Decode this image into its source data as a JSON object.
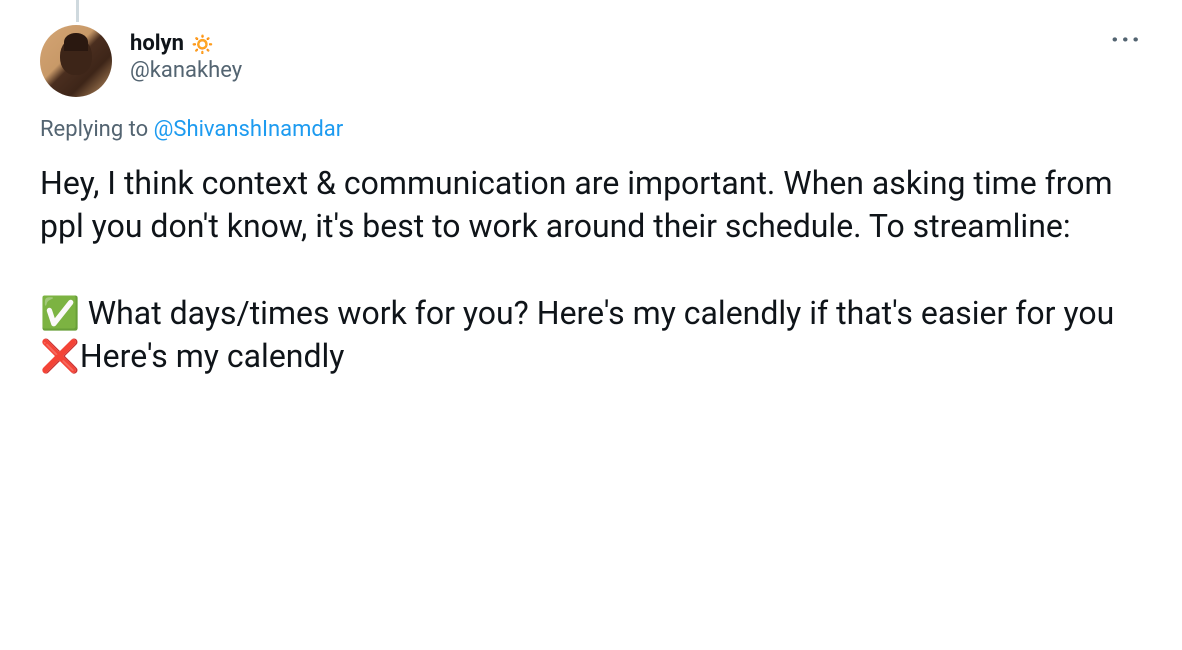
{
  "user": {
    "display_name": "holyn",
    "name_emoji": "🔅",
    "handle": "@kanakhey"
  },
  "reply": {
    "prefix": "Replying to ",
    "mention": "@ShivanshInamdar"
  },
  "tweet_text": "Hey, I think context & communication are important. When asking time from ppl you don't know, it's best to work around their schedule. To streamline:\n\n✅ What days/times work for you? Here's my calendly if that's easier for you\n❌Here's my calendly"
}
